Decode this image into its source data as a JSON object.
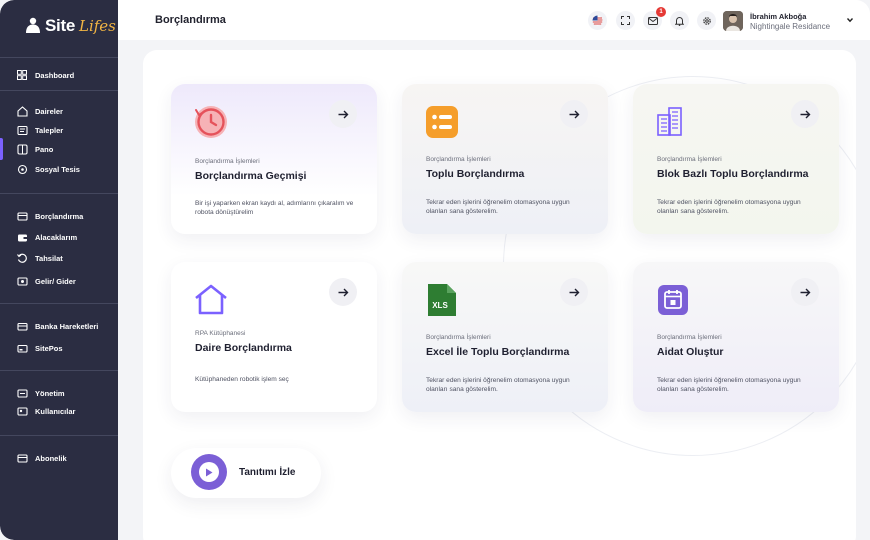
{
  "brand": {
    "name": "Site",
    "script": "Lifes"
  },
  "sidebar": {
    "items": [
      {
        "label": "Dashboard",
        "icon": "dashboard-icon"
      },
      {
        "label": "Daireler",
        "icon": "home-icon"
      },
      {
        "label": "Talepler",
        "icon": "request-icon"
      },
      {
        "label": "Pano",
        "icon": "board-icon"
      },
      {
        "label": "Sosyal Tesis",
        "icon": "facility-icon"
      },
      {
        "label": "Borçlandırma",
        "icon": "debt-icon"
      },
      {
        "label": "Alacaklarım",
        "icon": "wallet-icon"
      },
      {
        "label": "Tahsilat",
        "icon": "collection-icon"
      },
      {
        "label": "Gelir/ Gider",
        "icon": "income-expense-icon"
      },
      {
        "label": "Banka Hareketleri",
        "icon": "bank-icon"
      },
      {
        "label": "SitePos",
        "icon": "pos-icon"
      },
      {
        "label": "Yönetim",
        "icon": "management-icon"
      },
      {
        "label": "Kullanıcılar",
        "icon": "users-icon"
      },
      {
        "label": "Abonelik",
        "icon": "subscription-icon"
      }
    ],
    "active_item": "Pano"
  },
  "header": {
    "title": "Borçlandırma",
    "notification_count": "1",
    "user_name": "İbrahim Akboğa",
    "user_site": "Nightingale Residance"
  },
  "cards": [
    {
      "category": "Borçlandırma İşlemleri",
      "title": "Borçlandırma Geçmişi",
      "desc": "Bir işi yaparken ekran kaydı al, adımlarını çıkaralım ve robota dönüştürelim",
      "icon": "history-clock-icon"
    },
    {
      "category": "Borçlandırma İşlemleri",
      "title": "Toplu Borçlandırma",
      "desc": "Tekrar eden işlerini öğrenelim otomasyona uygun olanları sana gösterelim.",
      "icon": "list-toggle-icon"
    },
    {
      "category": "Borçlandırma İşlemleri",
      "title": "Blok Bazlı Toplu Borçlandırma",
      "desc": "Tekrar eden işlerini öğrenelim otomasyona uygun olanları sana gösterelim.",
      "icon": "building-icon"
    },
    {
      "category": "RPA Kütüphanesi",
      "title": "Daire Borçlandırma",
      "desc": "Kütüphaneden robotik işlem seç",
      "icon": "house-icon"
    },
    {
      "category": "Borçlandırma İşlemleri",
      "title": "Excel İle Toplu Borçlandırma",
      "desc": "Tekrar eden işlerini öğrenelim otomasyona uygun olanları sana gösterelim.",
      "icon": "xls-file-icon",
      "icon_text": "XLS"
    },
    {
      "category": "Borçlandırma İşlemleri",
      "title": "Aidat Oluştur",
      "desc": "Tekrar eden işlerini öğrenelim otomasyona uygun olanları sana gösterelim.",
      "icon": "calendar-icon"
    }
  ],
  "video": {
    "label": "Tanıtımı İzle"
  },
  "colors": {
    "sidebar": "#2b2d42",
    "accent": "#7b61ff",
    "orange": "#f59e2b",
    "excel": "#2e7d32",
    "red": "#e5525b"
  }
}
